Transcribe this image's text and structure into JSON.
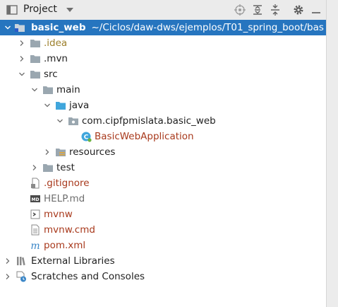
{
  "header": {
    "title": "Project",
    "tools": [
      "target-icon",
      "expand-all-icon",
      "collapse-all-icon",
      "gear-icon",
      "hide-icon"
    ]
  },
  "tree": {
    "root": {
      "name": "basic_web",
      "path": "~/Ciclos/daw-dws/ejemplos/T01_spring_boot/bas"
    },
    "idea": ".idea",
    "mvn": ".mvn",
    "src": "src",
    "main": "main",
    "java": "java",
    "package": "com.cipfpmislata.basic_web",
    "app_class": "BasicWebApplication",
    "resources": "resources",
    "test": "test",
    "gitignore": ".gitignore",
    "help": "HELP.md",
    "mvnw": "mvnw",
    "mvnw_cmd": "mvnw.cmd",
    "pom": "pom.xml",
    "external_libraries": "External Libraries",
    "scratches": "Scratches and Consoles"
  },
  "colors": {
    "selection": "#2675bf",
    "folder": "#9aa7b0",
    "source_folder": "#40a6dc",
    "ignored_text": "#9c7f2b",
    "modified_text": "#a8391c"
  }
}
